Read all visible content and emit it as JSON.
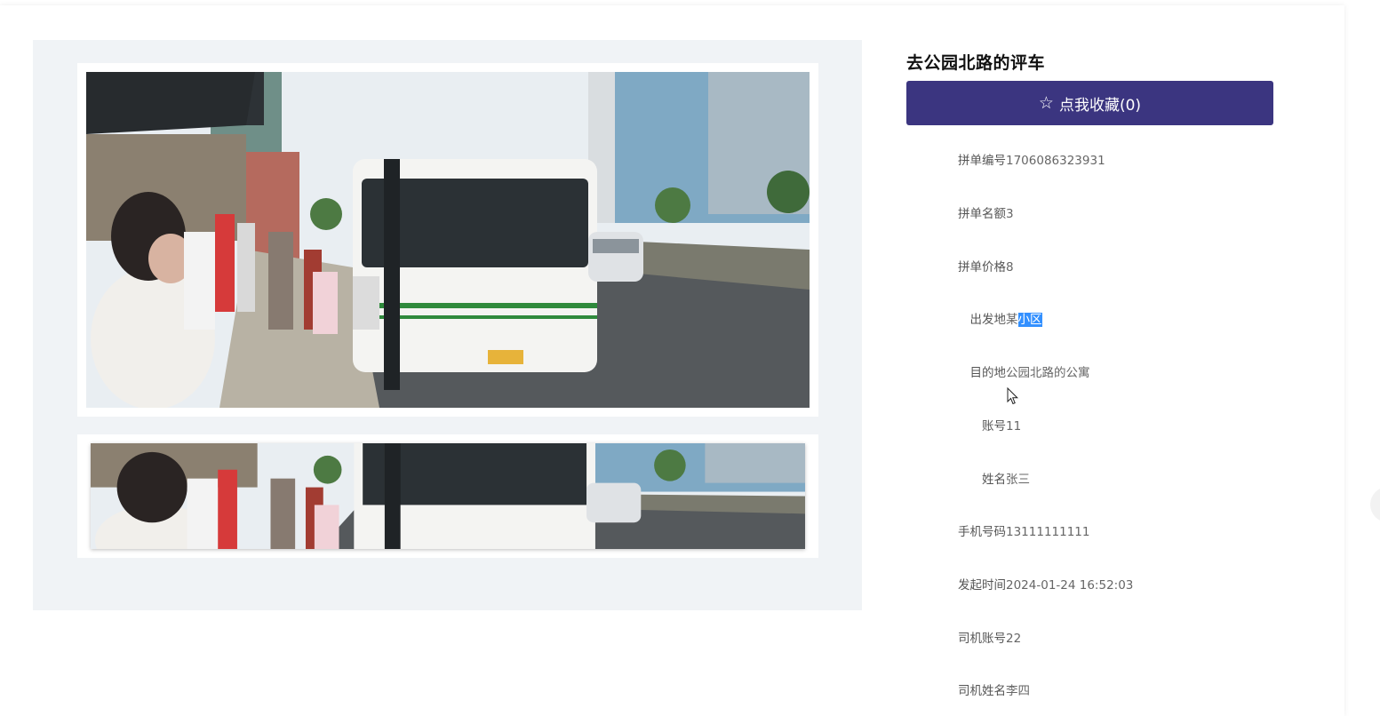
{
  "detail": {
    "title": "去公园北路的评车",
    "favorite_label": "点我收藏(0)",
    "favorite_icon": "star-outline-icon"
  },
  "images": {
    "main_alt": "",
    "thumbnails_count": 1
  },
  "fields": [
    {
      "label": "拼单编号",
      "value": "1706086323931"
    },
    {
      "label": "拼单名额",
      "value": "3"
    },
    {
      "label": "拼单价格",
      "value": "8"
    },
    {
      "label": "出发地",
      "value_prefix": "某",
      "value_selected": "小区"
    },
    {
      "label": "目的地",
      "value": "公园北路的公寓"
    },
    {
      "label": "账号",
      "value": "11"
    },
    {
      "label": "姓名",
      "value": "张三"
    },
    {
      "label": "手机号码",
      "value": "13111111111"
    },
    {
      "label": "发起时间",
      "value": "2024-01-24 16:52:03"
    },
    {
      "label": "司机账号",
      "value": "22"
    },
    {
      "label": "司机姓名",
      "value": "李四"
    }
  ],
  "colors": {
    "accent": "#3b3580",
    "selection": "#3390ff",
    "gallery_bg": "#f0f3f6"
  }
}
